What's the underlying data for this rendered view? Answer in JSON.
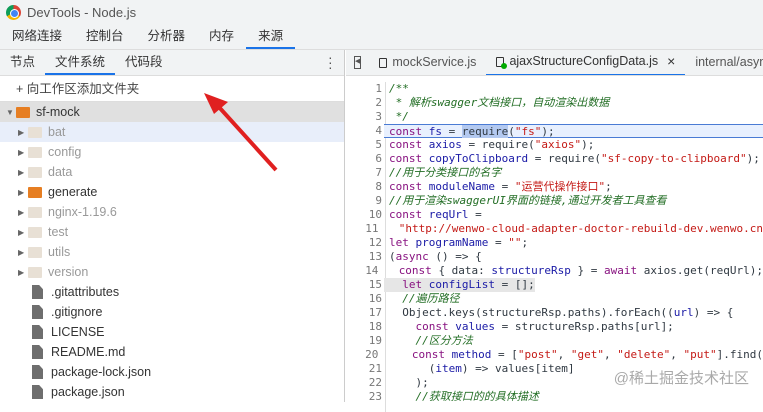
{
  "window": {
    "title": "DevTools - Node.js"
  },
  "main_tabs": [
    "网络连接",
    "控制台",
    "分析器",
    "内存",
    "来源"
  ],
  "sub_tabs": [
    "节点",
    "文件系统",
    "代码段"
  ],
  "add_folder": "+ 向工作区添加文件夹",
  "tree": {
    "root": "sf-mock",
    "folders": [
      {
        "name": "bat",
        "active": false
      },
      {
        "name": "config",
        "active": false
      },
      {
        "name": "data",
        "active": false
      },
      {
        "name": "generate",
        "active": true
      },
      {
        "name": "nginx-1.19.6",
        "active": false
      },
      {
        "name": "test",
        "active": false
      },
      {
        "name": "utils",
        "active": false
      },
      {
        "name": "version",
        "active": false
      }
    ],
    "files": [
      ".gitattributes",
      ".gitignore",
      "LICENSE",
      "README.md",
      "package-lock.json",
      "package.json"
    ]
  },
  "file_tabs": [
    "mockService.js",
    "ajaxStructureConfigData.js",
    "internal/async"
  ],
  "close_glyph": "×",
  "code": [
    [
      [
        "c",
        "/**"
      ]
    ],
    [
      [
        "c",
        " * 解析swagger文档接口，自动渲染出数据"
      ]
    ],
    [
      [
        "c",
        " */"
      ]
    ],
    [
      [
        "k",
        "const "
      ],
      [
        "v",
        "fs"
      ],
      [
        "p",
        " = "
      ],
      [
        "h",
        "require"
      ],
      [
        "p",
        "("
      ],
      [
        "s",
        "\"fs\""
      ],
      [
        "p",
        ");"
      ]
    ],
    [
      [
        "k",
        "const "
      ],
      [
        "v",
        "axios"
      ],
      [
        "p",
        " = require("
      ],
      [
        "s",
        "\"axios\""
      ],
      [
        "p",
        ");"
      ]
    ],
    [
      [
        "k",
        "const "
      ],
      [
        "v",
        "copyToClipboard"
      ],
      [
        "p",
        " = require("
      ],
      [
        "s",
        "\"sf-copy-to-clipboard\""
      ],
      [
        "p",
        ");"
      ]
    ],
    [
      [
        "c",
        "//用于分类接口的名字"
      ]
    ],
    [
      [
        "k",
        "const "
      ],
      [
        "v",
        "moduleName"
      ],
      [
        "p",
        " = "
      ],
      [
        "s",
        "\"运营代操作接口\""
      ],
      [
        "p",
        ";"
      ]
    ],
    [
      [
        "c",
        "//用于渲染swaggerUI界面的链接,通过开发者工具查看"
      ]
    ],
    [
      [
        "k",
        "const "
      ],
      [
        "v",
        "reqUrl"
      ],
      [
        "p",
        " ="
      ]
    ],
    [
      [
        "p",
        "  "
      ],
      [
        "s",
        "\"http://wenwo-cloud-adapter-doctor-rebuild-dev.wenwo.cn"
      ]
    ],
    [
      [
        "k",
        "let "
      ],
      [
        "v",
        "programName"
      ],
      [
        "p",
        " = "
      ],
      [
        "s",
        "\"\""
      ],
      [
        "p",
        ";"
      ]
    ],
    [
      [
        "p",
        "("
      ],
      [
        "k",
        "async"
      ],
      [
        "p",
        " () => {"
      ]
    ],
    [
      [
        "p",
        "  "
      ],
      [
        "k",
        "const "
      ],
      [
        "p",
        "{ data: "
      ],
      [
        "v",
        "structureRsp"
      ],
      [
        "p",
        " } = "
      ],
      [
        "k",
        "await "
      ],
      [
        "p",
        "axios.get(reqUrl);"
      ]
    ],
    [
      [
        "p",
        "  "
      ],
      [
        "k",
        "let "
      ],
      [
        "v",
        "configList"
      ],
      [
        "p",
        " = [];"
      ]
    ],
    [
      [
        "p",
        "  "
      ],
      [
        "c",
        "//遍历路径"
      ]
    ],
    [
      [
        "p",
        "  Object.keys(structureRsp.paths).forEach(("
      ],
      [
        "v",
        "url"
      ],
      [
        "p",
        ") => {"
      ]
    ],
    [
      [
        "p",
        "    "
      ],
      [
        "k",
        "const "
      ],
      [
        "v",
        "values"
      ],
      [
        "p",
        " = structureRsp.paths[url];"
      ]
    ],
    [
      [
        "p",
        "    "
      ],
      [
        "c",
        "//区分方法"
      ]
    ],
    [
      [
        "p",
        "    "
      ],
      [
        "k",
        "const "
      ],
      [
        "v",
        "method"
      ],
      [
        "p",
        " = ["
      ],
      [
        "s",
        "\"post\""
      ],
      [
        "p",
        ", "
      ],
      [
        "s",
        "\"get\""
      ],
      [
        "p",
        ", "
      ],
      [
        "s",
        "\"delete\""
      ],
      [
        "p",
        ", "
      ],
      [
        "s",
        "\"put\""
      ],
      [
        "p",
        "].find("
      ]
    ],
    [
      [
        "p",
        "      ("
      ],
      [
        "v",
        "item"
      ],
      [
        "p",
        ") => values[item]"
      ]
    ],
    [
      [
        "p",
        "    );"
      ]
    ],
    [
      [
        "p",
        "    "
      ],
      [
        "c",
        "//获取接口的的具体描述"
      ]
    ]
  ],
  "selected_line": 4,
  "current_line": 15,
  "watermark": "@稀土掘金技术社区"
}
